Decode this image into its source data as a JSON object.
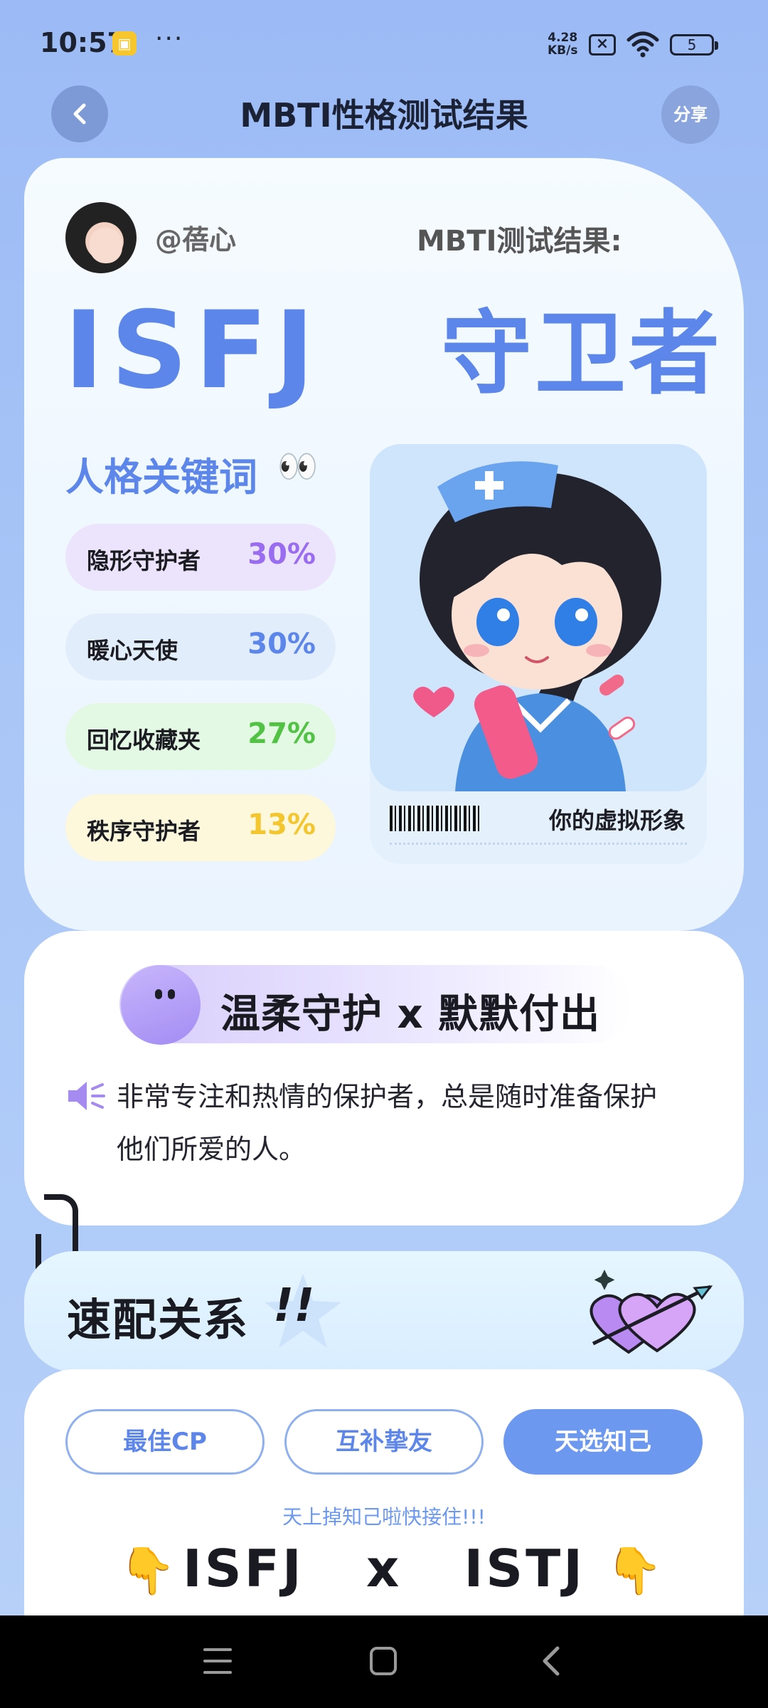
{
  "status_bar": {
    "time": "10:57",
    "app_badge": "",
    "dots": "···",
    "net_speed_value": "4.28",
    "net_speed_unit": "KB/s",
    "battery": "5"
  },
  "header": {
    "title": "MBTI性格测试结果",
    "share_label": "分享"
  },
  "profile": {
    "username": "@蓓心",
    "result_label": "MBTI测试结果:",
    "mbti_type": "ISFJ",
    "mbti_name": "守卫者"
  },
  "keywords": {
    "title": "人格关键词",
    "eyes_emoji": "👀",
    "items": [
      {
        "name": "隐形守护者",
        "pct": "30%",
        "color": "#9a6cf0"
      },
      {
        "name": "暖心天使",
        "pct": "30%",
        "color": "#5d86ea"
      },
      {
        "name": "回忆收藏夹",
        "pct": "27%",
        "color": "#52c245"
      },
      {
        "name": "秩序守护者",
        "pct": "13%",
        "color": "#f3c52e"
      }
    ]
  },
  "avatar_card": {
    "caption": "你的虚拟形象"
  },
  "motto": {
    "text": "温柔守护 x 默默付出",
    "description_line1": "非常专注和热情的保护者，总是随时准备保护",
    "description_line2": "他们所爱的人。"
  },
  "match": {
    "title": "速配关系",
    "bang": "!!",
    "tabs": [
      {
        "label": "最佳CP",
        "selected": false
      },
      {
        "label": "互补挚友",
        "selected": false
      },
      {
        "label": "天选知己",
        "selected": true
      }
    ],
    "caption": "天上掉知己啦快接住!!!",
    "pair_left": "ISFJ",
    "pair_x": "x",
    "pair_right": "ISTJ",
    "pointer_emoji": "👇"
  },
  "colors": {
    "accent": "#5d86ea",
    "tab_selected": "#6c98f0"
  }
}
